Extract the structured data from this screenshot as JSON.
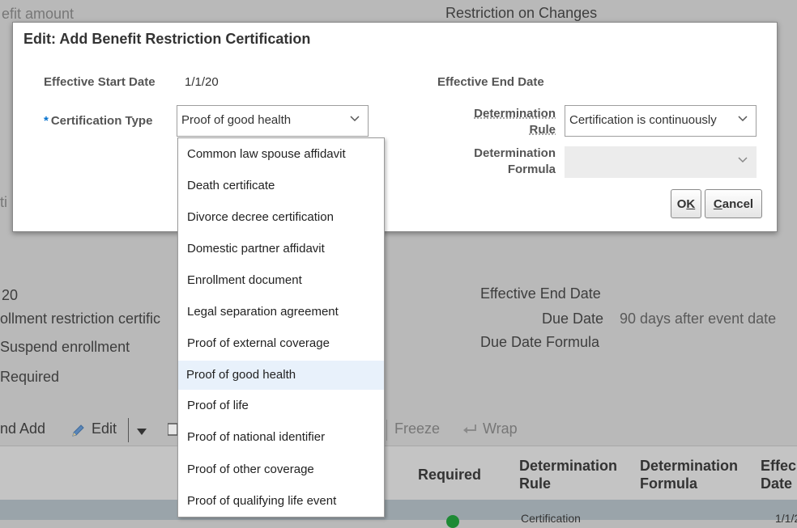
{
  "background": {
    "top_left_text": "efit amount",
    "top_center_text": "Restriction on Changes",
    "left_edge_letters": "ti",
    "left_texts": [
      "20",
      "ollment restriction certific",
      "Suspend enrollment",
      "Required"
    ],
    "right_labels": {
      "effective_end_date": "Effective End Date",
      "due_date": "Due Date",
      "due_date_value": "90 days after event date",
      "due_date_formula": "Due Date Formula"
    },
    "toolbar": {
      "add_label": "nd Add",
      "edit_label": "Edit",
      "freeze_label": "Freeze",
      "wrap_label": "Wrap"
    },
    "table_headers": {
      "required": "Required",
      "determination_rule_1": "Determination",
      "determination_rule_2": "Rule",
      "determination_formula_1": "Determination",
      "determination_formula_2": "Formula",
      "effective_1": "Effec",
      "effective_2": "Date"
    },
    "bottom_row": {
      "rule_text": "Certification",
      "date_text": "1/1/2"
    }
  },
  "dialog": {
    "title": "Edit: Add Benefit Restriction Certification",
    "effective_start_date_label": "Effective Start Date",
    "effective_start_date_value": "1/1/20",
    "effective_end_date_label": "Effective End Date",
    "required_marker": "*",
    "certification_type_label": "Certification Type",
    "certification_type_value": "Proof of good health",
    "determination_rule_label_1": "Determination",
    "determination_rule_label_2": "Rule",
    "determination_rule_value": "Certification is continuously",
    "determination_formula_label_1": "Determination",
    "determination_formula_label_2": "Formula",
    "determination_formula_value": "",
    "ok_prefix": "O",
    "ok_mnemonic": "K",
    "cancel_mnemonic": "C",
    "cancel_suffix": "ancel"
  },
  "dropdown": {
    "selected_index": 7,
    "options": [
      "Common law spouse affidavit",
      "Death certificate",
      "Divorce decree certification",
      "Domestic partner affidavit",
      "Enrollment document",
      "Legal separation agreement",
      "Proof of external coverage",
      "Proof of good health",
      "Proof of life",
      "Proof of national identifier",
      "Proof of other coverage",
      "Proof of qualifying life event"
    ]
  },
  "colors": {
    "required_marker": "#0572ce",
    "selected_option_bg": "#e8f1fb",
    "status_green": "#1e8a35"
  }
}
